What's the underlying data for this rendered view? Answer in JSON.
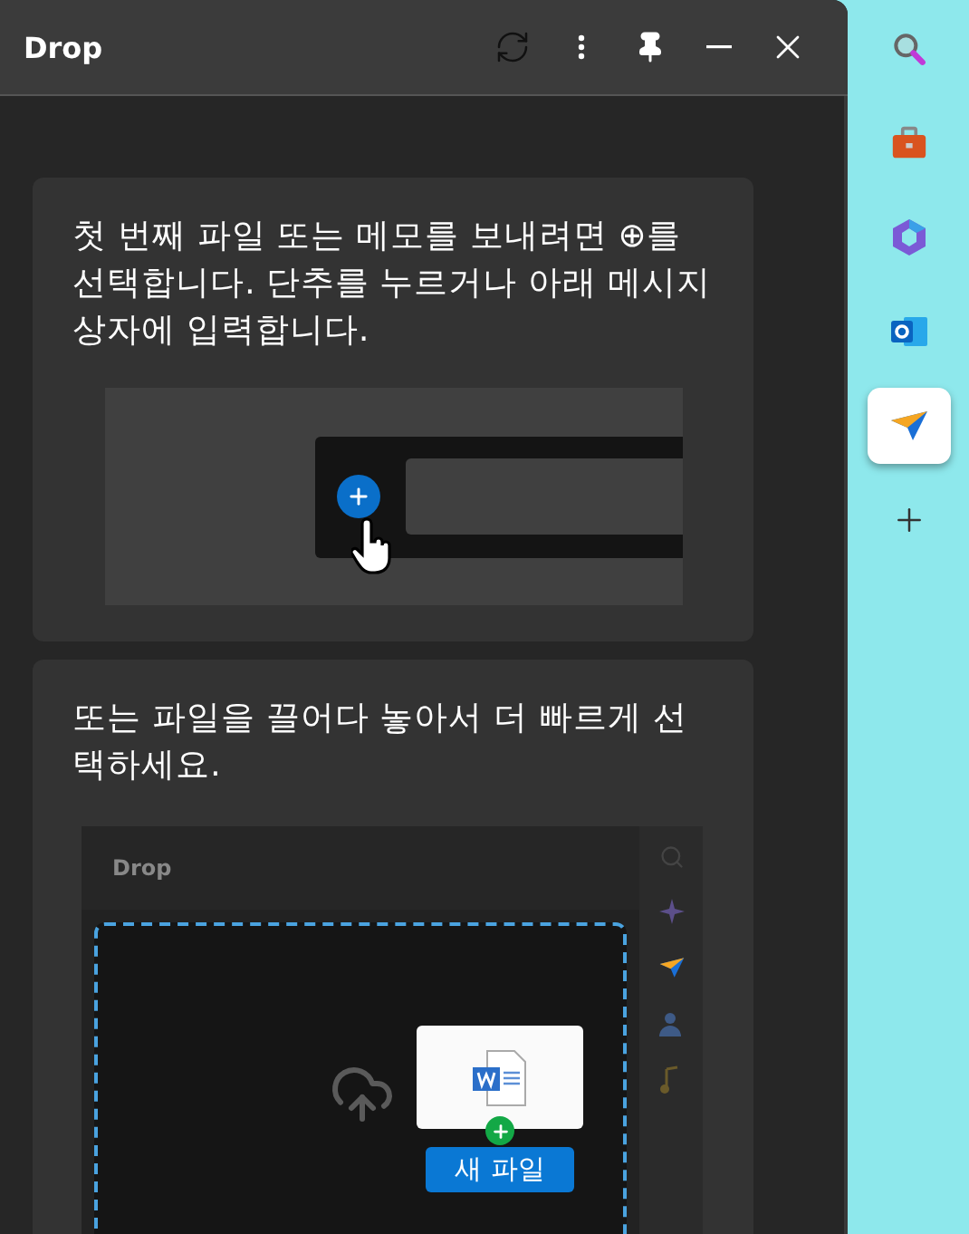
{
  "window": {
    "title": "Drop"
  },
  "cards": [
    {
      "kind": "message_box",
      "text": "첫 번째 파일 또는 메모를 보내려면 ⊕를 선택합니다. 단추를 누르거나 아래 메시지 상자에 입력합니다."
    },
    {
      "kind": "drag_drop",
      "text": "또는 파일을 끌어다 놓아서 더 빠르게 선택하세요.",
      "preview_title": "Drop",
      "file_label": "새 파일"
    }
  ],
  "sidebar": {
    "items": [
      {
        "kind": "search",
        "selected": false
      },
      {
        "kind": "toolbox",
        "selected": false
      },
      {
        "kind": "copilot",
        "selected": false
      },
      {
        "kind": "outlook",
        "selected": false
      },
      {
        "kind": "drop",
        "selected": true
      },
      {
        "kind": "add",
        "selected": false
      }
    ]
  }
}
